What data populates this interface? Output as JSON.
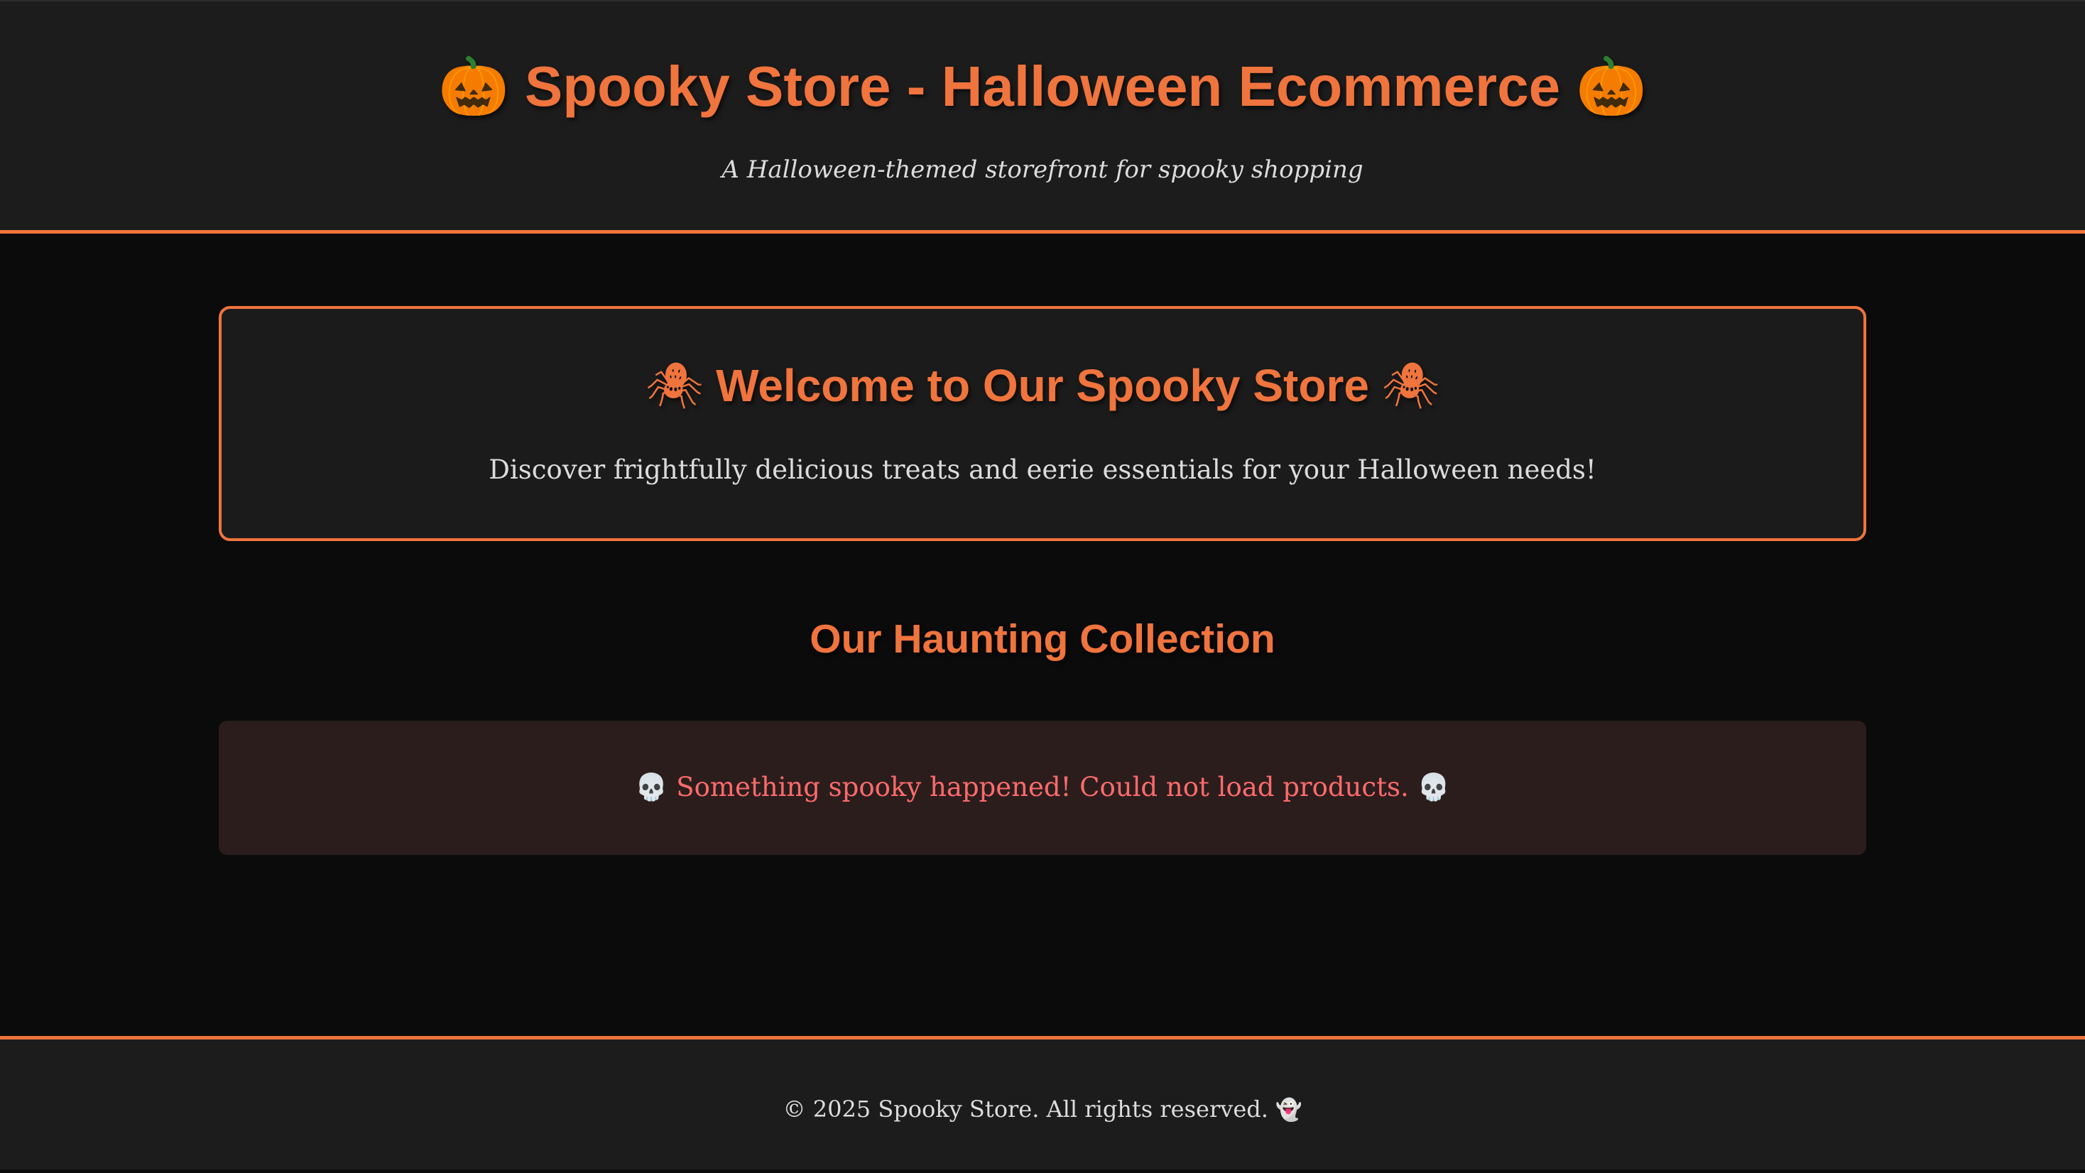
{
  "header": {
    "title_icon_left": "🎃",
    "title": "Spooky Store - Halloween Ecommerce",
    "title_icon_right": "🎃",
    "subtitle": "A Halloween-themed storefront for spooky shopping"
  },
  "welcome": {
    "icon_left": "🕷",
    "title": "Welcome to Our Spooky Store",
    "icon_right": "🕷",
    "text": "Discover frightfully delicious treats and eerie essentials for your Halloween needs!"
  },
  "collection": {
    "title": "Our Haunting Collection",
    "error": {
      "icon_left": "💀",
      "message": "Something spooky happened! Could not load products.",
      "icon_right": "💀"
    }
  },
  "footer": {
    "text": "© 2025 Spooky Store. All rights reserved.",
    "icon": "👻"
  },
  "colors": {
    "accent": "#f0743d",
    "background": "#0b0b0b",
    "panel": "#1c1c1c",
    "error_bg": "#2c1d1d",
    "error_text": "#ff6b6b"
  },
  "icons": {
    "title_icons": "pumpkin-icon",
    "welcome_icons": "spider-icon",
    "error_icons": "skull-icon",
    "footer_icon": "ghost-icon"
  }
}
